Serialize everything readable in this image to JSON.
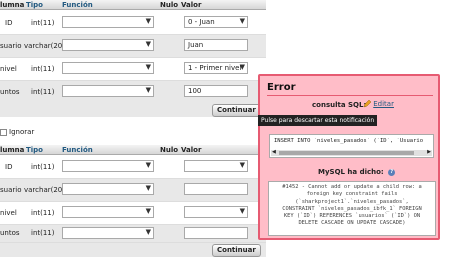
{
  "table_header": {
    "col1": "lumna",
    "col2": "Tipo",
    "col3": "Función",
    "col4": "Nulo",
    "col5": "Valor"
  },
  "form1": {
    "rows": [
      {
        "column": "ID",
        "type": "int(11)",
        "value": "0 - Juan",
        "kind": "select"
      },
      {
        "column": "suario",
        "type": "varchar(20)",
        "value": "Juan",
        "kind": "input"
      },
      {
        "column": "nivel",
        "type": "int(11)",
        "value": "1 - Primer nivel",
        "kind": "select"
      },
      {
        "column": "untos",
        "type": "int(11)",
        "value": "100",
        "kind": "input"
      }
    ],
    "continue_label": "Continuar"
  },
  "ignore_label": "Ignorar",
  "form2": {
    "rows": [
      {
        "column": "ID",
        "type": "int(11)"
      },
      {
        "column": "suario",
        "type": "varchar(20)"
      },
      {
        "column": "nivel",
        "type": "int(11)"
      },
      {
        "column": "untos",
        "type": "int(11)"
      }
    ],
    "continue_label": "Continuar"
  },
  "error_dialog": {
    "title": "Error",
    "sql_label": "consulta SQL:",
    "edit_link": "Editar",
    "tooltip": "Pulse para descartar esta notificación",
    "sql_text": "INSERT INTO `niveles_pasados` (`ID`, `Usuario",
    "mysql_said": "MySQL ha dicho:",
    "error_lines": [
      "#1452 - Cannot add or update a child row: a",
      "foreign key constraint fails",
      "(`sharkproject1`.`niveles_pasados`,",
      "CONSTRAINT `niveles_pasados_ibfk_1` FOREIGN",
      "KEY (`ID`) REFERENCES `usuarios` (`ID`) ON",
      "DELETE CASCADE ON UPDATE CASCADE)"
    ]
  },
  "colors": {
    "dialog_bg": "#ffbdc8",
    "dialog_border": "#e65b72",
    "link": "#235a81"
  }
}
